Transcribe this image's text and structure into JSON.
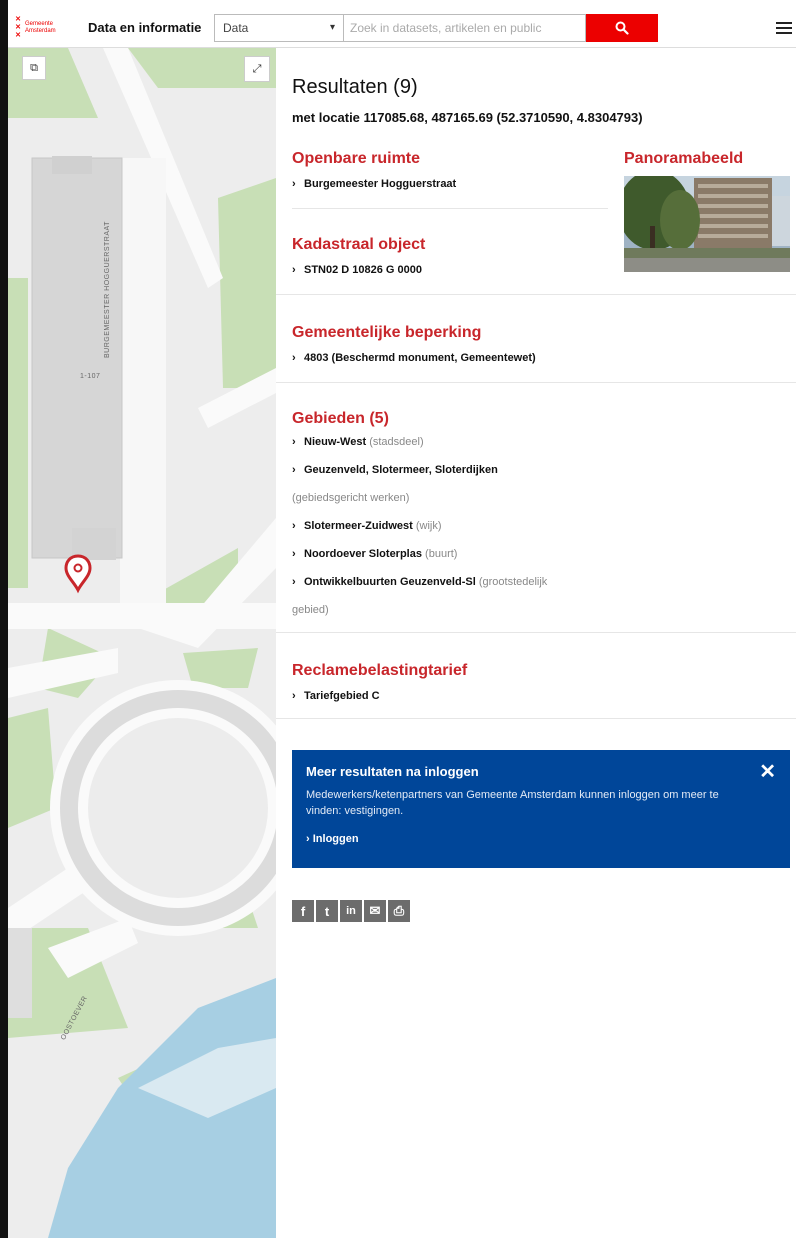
{
  "header": {
    "logo_line1": "Gemeente",
    "logo_line2": "Amsterdam",
    "app_title": "Data en informatie",
    "category_select": "Data",
    "search_placeholder": "Zoek in datasets, artikelen en public"
  },
  "map": {
    "street_label_1": "BURGEMEESTER HOGGUERSTRAAT",
    "street_label_2": "OOSTOEVER",
    "building_number": "1-107"
  },
  "results": {
    "title": "Resultaten (9)",
    "location": "met locatie 117085.68, 487165.69 (52.3710590, 4.8304793)",
    "openbare_ruimte": {
      "title": "Openbare ruimte",
      "item": "Burgemeester Hogguerstraat"
    },
    "panorama": {
      "title": "Panoramabeeld"
    },
    "kadastraal": {
      "title": "Kadastraal object",
      "item": "STN02 D 10826 G 0000"
    },
    "beperking": {
      "title": "Gemeentelijke beperking",
      "item": "4803 (Beschermd monument, Gemeentewet)"
    },
    "gebieden": {
      "title": "Gebieden (5)",
      "items": [
        {
          "label": "Nieuw-West",
          "sub": "(stadsdeel)"
        },
        {
          "label": "Geuzenveld, Slotermeer, Sloterdijken",
          "sub": ""
        },
        {
          "label": "Slotermeer-Zuidwest",
          "sub": "(wijk)"
        },
        {
          "label": "Noordoever Sloterplas",
          "sub": "(buurt)"
        },
        {
          "label": "Ontwikkelbuurten Geuzenveld-Sl",
          "sub": "(grootstedelijk"
        }
      ],
      "continuation_1": "(gebiedsgericht werken)",
      "continuation_2": "gebied)"
    },
    "reclame": {
      "title": "Reclamebelastingtarief",
      "item": "Tariefgebied C"
    }
  },
  "notice": {
    "title": "Meer resultaten na inloggen",
    "text": "Medewerkers/ketenpartners van Gemeente Amsterdam kunnen inloggen om meer te vinden: vestigingen.",
    "link": "Inloggen"
  },
  "share": {
    "facebook": "f",
    "twitter": "t",
    "linkedin": "in",
    "email": "✉",
    "print": "⎙"
  },
  "colors": {
    "accent_red": "#ec0000",
    "section_red": "#c8262b",
    "notice_blue": "#004699",
    "water": "#a7cfe3",
    "park": "#c8dfb6"
  }
}
